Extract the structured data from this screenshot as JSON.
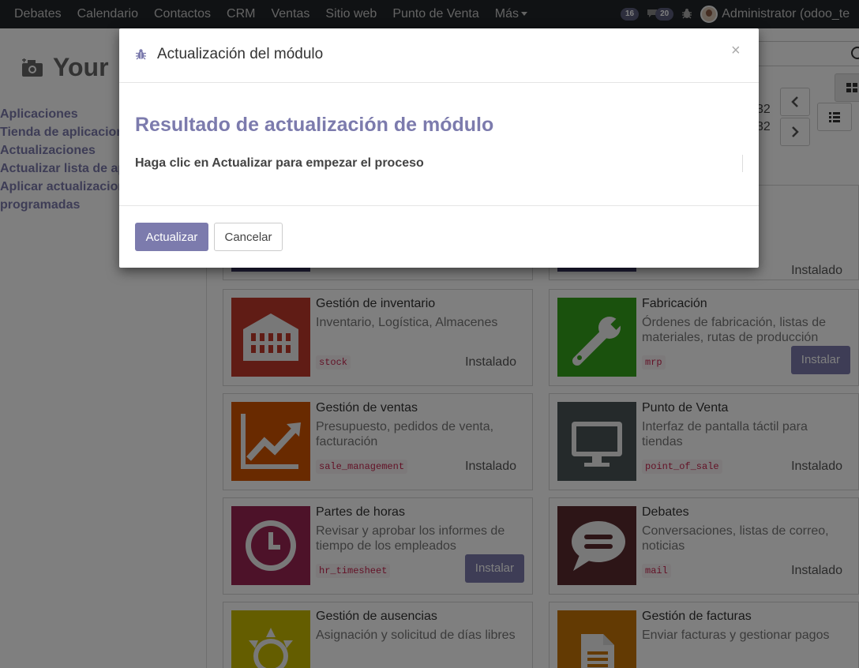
{
  "topbar": {
    "menu": [
      "Debates",
      "Calendario",
      "Contactos",
      "CRM",
      "Ventas",
      "Sitio web",
      "Punto de Venta",
      "Más"
    ],
    "messages_count": "16",
    "chat_count": "20",
    "user_name": "Administrator (odoo_te"
  },
  "page": {
    "title": "Your",
    "sidebar": [
      "Aplicaciones",
      "Tienda de aplicacion",
      "Actualizaciones",
      "Actualizar lista de ap",
      "Aplicar actualizacion",
      "programadas"
    ],
    "pager_line1": "32",
    "pager_line2": "32",
    "cards": [
      {
        "name": "Gestión de inventario",
        "desc": "Inventario, Logística, Almacenes",
        "tech": "stock",
        "status": "Instalado",
        "button": "",
        "color": "#b0332c",
        "icon": "building-icon"
      },
      {
        "name": "Fabricación",
        "desc": "Órdenes de fabricación, listas de materiales, rutas de producción",
        "tech": "mrp",
        "status": "",
        "button": "Instalar",
        "color": "#2f7d1b",
        "icon": "wrench-icon"
      },
      {
        "name": "Gestión de ventas",
        "desc": "Presupuesto, pedidos de venta, facturación",
        "tech": "sale_management",
        "status": "Instalado",
        "button": "",
        "color": "#b84b03",
        "icon": "chart-trend-icon"
      },
      {
        "name": "Punto de Venta",
        "desc": "Interfaz de pantalla táctil para tiendas",
        "tech": "point_of_sale",
        "status": "Instalado",
        "button": "",
        "color": "#3b4446",
        "icon": "monitor-icon"
      },
      {
        "name": "Partes de horas",
        "desc": "Revisar y aprobar los informes de tiempo de los empleados",
        "tech": "hr_timesheet",
        "status": "",
        "button": "Instalar",
        "color": "#7a1e3b",
        "icon": "clock-icon"
      },
      {
        "name": "Debates",
        "desc": "Conversaciones, listas de correo, noticias",
        "tech": "mail",
        "status": "Instalado",
        "button": "",
        "color": "#3f1f22",
        "icon": "speech-bubble-icon"
      },
      {
        "name": "Gestión de ausencias",
        "desc": "Asignación y solicitud de días libres",
        "tech": "",
        "status": "",
        "button": "",
        "color": "#7a7000",
        "icon": "sun-icon"
      },
      {
        "name": "Gestión de facturas",
        "desc": "Enviar facturas y gestionar pagos",
        "tech": "",
        "status": "",
        "button": "",
        "color": "#8a4a05",
        "icon": "document-icon"
      }
    ],
    "top_right_status": "Instalado"
  },
  "modal": {
    "title": "Actualización del módulo",
    "close": "×",
    "heading": "Resultado de actualización de módulo",
    "text": "Haga clic en Actualizar para empezar el proceso",
    "primary_label": "Actualizar",
    "cancel_label": "Cancelar"
  },
  "colors": {
    "accent": "#7c7bad",
    "navbar": "#212529"
  }
}
